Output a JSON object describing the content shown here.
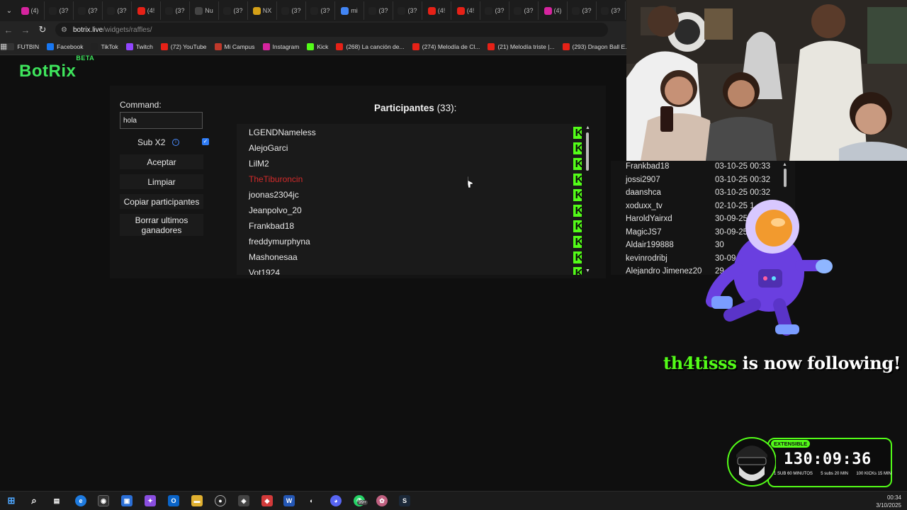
{
  "browser": {
    "tabs": [
      {
        "label": "(4)",
        "icon": "instagram-icon",
        "color": "#d6249f"
      },
      {
        "label": "(3?",
        "icon": "tiktok-icon",
        "color": "#222222"
      },
      {
        "label": "(3?",
        "icon": "tiktok-icon",
        "color": "#222222"
      },
      {
        "label": "(3?",
        "icon": "tiktok-icon",
        "color": "#222222"
      },
      {
        "label": "(4!",
        "icon": "youtube-icon",
        "color": "#e62117"
      },
      {
        "label": "(3?",
        "icon": "tiktok-icon",
        "color": "#222222"
      },
      {
        "label": "Nu",
        "icon": "github-icon",
        "color": "#444444"
      },
      {
        "label": "(3?",
        "icon": "tiktok-icon",
        "color": "#222222"
      },
      {
        "label": "NX",
        "icon": "coin-icon",
        "color": "#d4a017"
      },
      {
        "label": "(3?",
        "icon": "tiktok-icon",
        "color": "#222222"
      },
      {
        "label": "(3?",
        "icon": "tiktok-icon",
        "color": "#222222"
      },
      {
        "label": "mi",
        "icon": "google-icon",
        "color": "#4285f4"
      },
      {
        "label": "(3?",
        "icon": "tiktok-icon",
        "color": "#222222"
      },
      {
        "label": "(3?",
        "icon": "tiktok-icon",
        "color": "#222222"
      },
      {
        "label": "(4!",
        "icon": "youtube-icon",
        "color": "#e62117"
      },
      {
        "label": "(4!",
        "icon": "youtube-icon",
        "color": "#e62117"
      },
      {
        "label": "(3?",
        "icon": "tiktok-icon",
        "color": "#222222"
      },
      {
        "label": "(3?",
        "icon": "tiktok-icon",
        "color": "#222222"
      },
      {
        "label": "(4)",
        "icon": "instagram-icon",
        "color": "#d6249f"
      },
      {
        "label": "(3?",
        "icon": "tiktok-icon",
        "color": "#222222"
      },
      {
        "label": "(3?",
        "icon": "tiktok-icon",
        "color": "#222222"
      }
    ],
    "url_host": "botrix.live",
    "url_path": "/widgets/raffles/",
    "bookmarks": [
      {
        "label": "FUTBIN",
        "icon": "futbin-icon",
        "color": "#333333"
      },
      {
        "label": "Facebook",
        "icon": "facebook-icon",
        "color": "#1877f2"
      },
      {
        "label": "TikTok",
        "icon": "tiktok-icon",
        "color": "#222222"
      },
      {
        "label": "Twitch",
        "icon": "twitch-icon",
        "color": "#9146ff"
      },
      {
        "label": "(72) YouTube",
        "icon": "youtube-icon",
        "color": "#e62117"
      },
      {
        "label": "Mi Campus",
        "icon": "campus-icon",
        "color": "#c0392b"
      },
      {
        "label": "Instagram",
        "icon": "instagram-icon",
        "color": "#d6249f"
      },
      {
        "label": "Kick",
        "icon": "kick-icon",
        "color": "#53fc18"
      },
      {
        "label": "(268) La canción de...",
        "icon": "youtube-icon",
        "color": "#e62117"
      },
      {
        "label": "(274) Melodía de Cl...",
        "icon": "youtube-icon",
        "color": "#e62117"
      },
      {
        "label": "(21) Melodía triste |...",
        "icon": "youtube-icon",
        "color": "#e62117"
      },
      {
        "label": "(293) Dragon Ball E...",
        "icon": "youtube-icon",
        "color": "#e62117"
      }
    ]
  },
  "app": {
    "logo": "BotRix",
    "logo_badge": "BETA",
    "command_label": "Command:",
    "command_value": "hola",
    "sub_label": "Sub X2",
    "sub_checked": true,
    "buttons": {
      "accept": "Aceptar",
      "clear": "Limpiar",
      "copy": "Copiar participantes",
      "delete": "Borrar ultimos ganadores"
    },
    "participants_title": "Participantes",
    "participants_count": "(33):",
    "participants": [
      {
        "name": "LGENDNameless",
        "highlight": false
      },
      {
        "name": "AlejoGarci",
        "highlight": false
      },
      {
        "name": "LilM2",
        "highlight": false
      },
      {
        "name": "TheTiburoncin",
        "highlight": true
      },
      {
        "name": "joonas2304jc",
        "highlight": false
      },
      {
        "name": "Jeanpolvo_20",
        "highlight": false
      },
      {
        "name": "Frankbad18",
        "highlight": false
      },
      {
        "name": "freddymurphyna",
        "highlight": false
      },
      {
        "name": "Mashonesaa",
        "highlight": false
      },
      {
        "name": "Vot1924",
        "highlight": false
      }
    ],
    "platform_badge": "K",
    "winners": [
      {
        "name": "Frankbad18",
        "date": "03-10-25 00:33"
      },
      {
        "name": "jossi2907",
        "date": "03-10-25 00:32"
      },
      {
        "name": "daanshca",
        "date": "03-10-25 00:32"
      },
      {
        "name": "xoduxx_tv",
        "date": "02-10-25 1"
      },
      {
        "name": "HaroldYairxd",
        "date": "30-09-25"
      },
      {
        "name": "MagicJS7",
        "date": "30-09-25"
      },
      {
        "name": "Aldair199888",
        "date": "30"
      },
      {
        "name": "kevinrodribj",
        "date": "30-09-25"
      },
      {
        "name": "Alejandro Jimenez20",
        "date": "29-09-25"
      }
    ]
  },
  "overlay": {
    "follow_user": "th4tisss",
    "follow_text": "is now following!",
    "timer_badge": "EXTENSIBLE",
    "timer_value": "130:09:36",
    "timer_legend": [
      "1 SUB 60 MINUTOS",
      "5 subs 20 MIN",
      "100 KICKs 15 MIN"
    ]
  },
  "taskbar": {
    "time": "00:34",
    "date": "3/10/2025",
    "notif_badge": "99+"
  },
  "colors": {
    "kick_green": "#53fc18",
    "highlight_red": "#d22a2a",
    "checkbox_blue": "#2f7cf6"
  }
}
